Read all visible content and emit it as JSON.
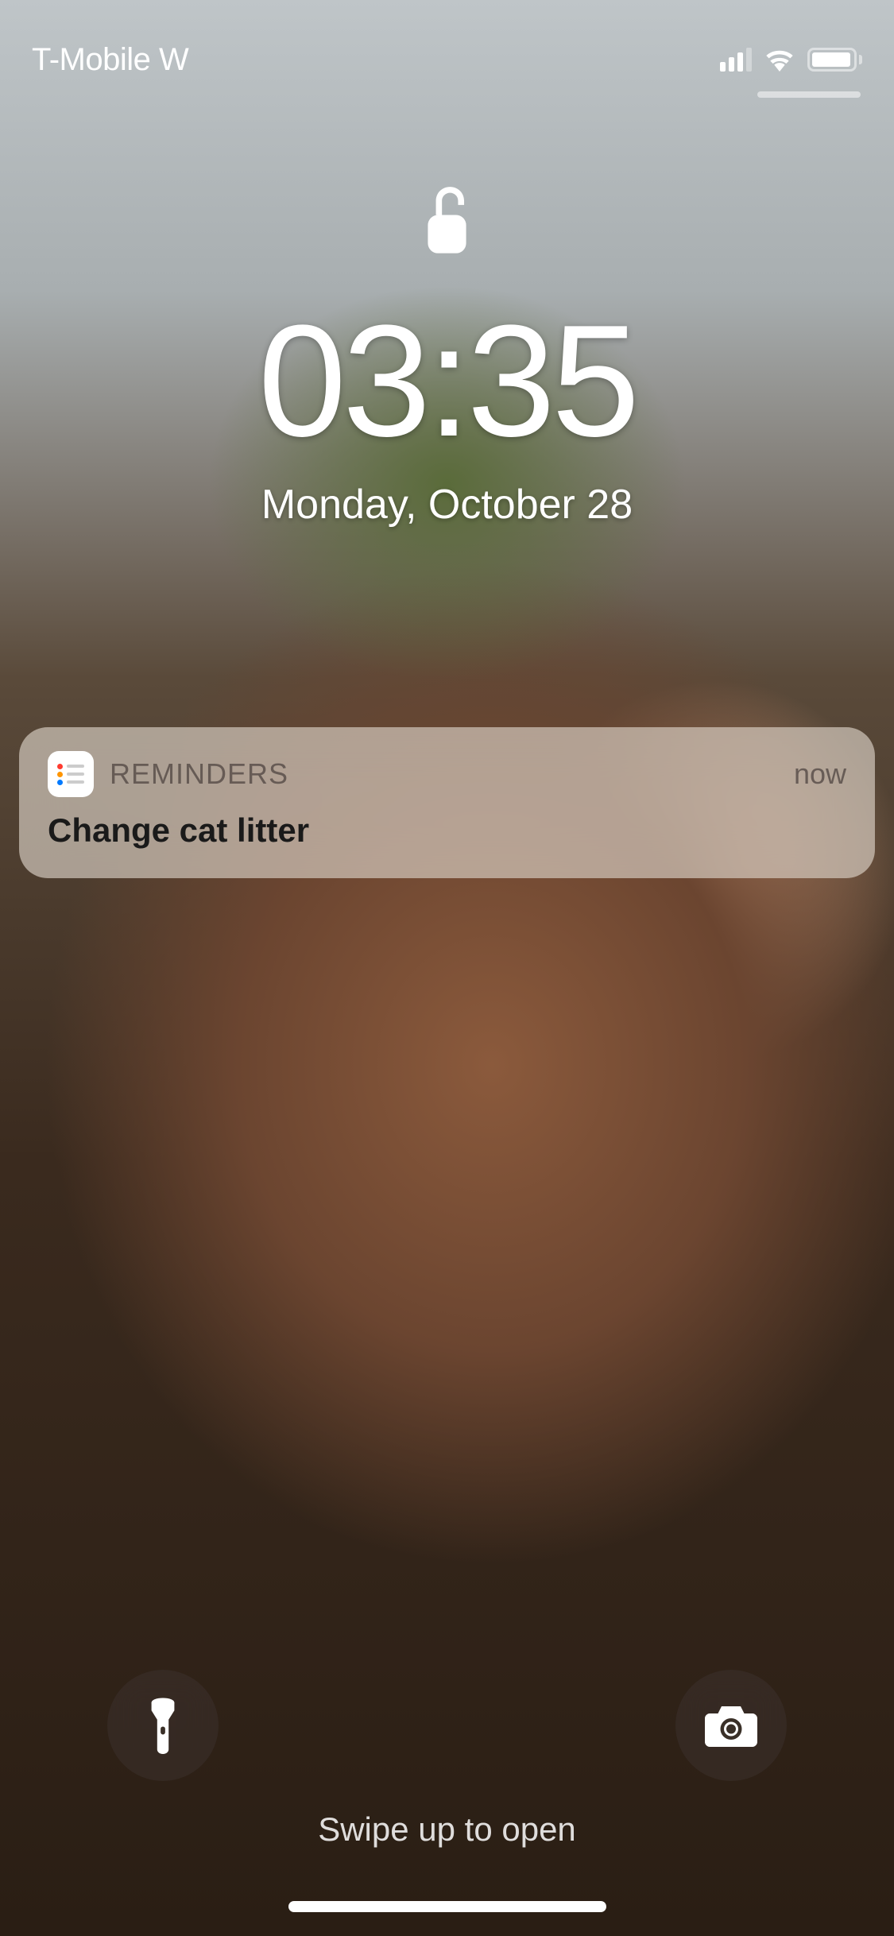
{
  "status_bar": {
    "carrier": "T-Mobile W"
  },
  "lock_screen": {
    "time": "03:35",
    "date": "Monday, October 28"
  },
  "notification": {
    "app_name": "REMINDERS",
    "timestamp": "now",
    "title": "Change cat litter"
  },
  "bottom": {
    "swipe_hint": "Swipe up to open"
  }
}
